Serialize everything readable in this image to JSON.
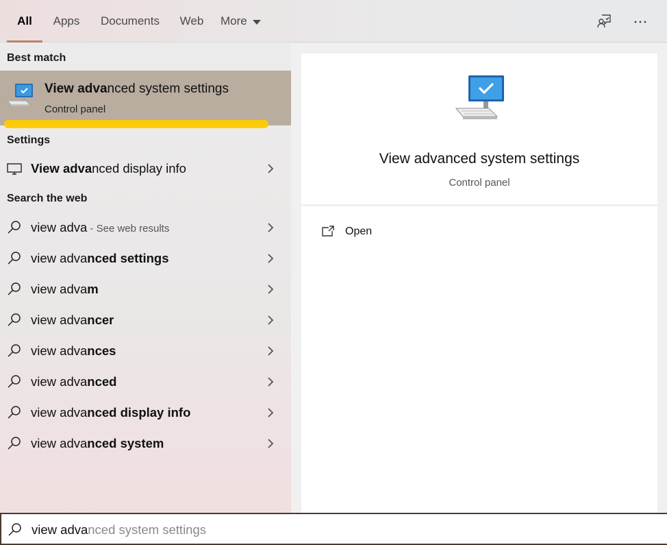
{
  "tabs": [
    {
      "label": "All",
      "active": true
    },
    {
      "label": "Apps"
    },
    {
      "label": "Documents"
    },
    {
      "label": "Web"
    },
    {
      "label": "More"
    }
  ],
  "top_icons": [
    "feedback-icon",
    "more-options-icon"
  ],
  "sections": {
    "best_match": "Best match",
    "settings": "Settings",
    "search_web": "Search the web"
  },
  "best_match": {
    "title_bold": "View adva",
    "title_rest": "nced system settings",
    "subtitle": "Control panel",
    "icon": "computer-monitor-icon"
  },
  "settings_items": [
    {
      "bold": "View adva",
      "rest": "nced display info"
    }
  ],
  "web_items": [
    {
      "plain": "view adva",
      "suffix": " - See web results"
    },
    {
      "plain": "view adva",
      "bold": "nced settings"
    },
    {
      "plain": "view adva",
      "bold": "m"
    },
    {
      "plain": "view adva",
      "bold": "ncer"
    },
    {
      "plain": "view adva",
      "bold": "nces"
    },
    {
      "plain": "view adva",
      "bold": "nced"
    },
    {
      "plain": "view adva",
      "bold": "nced display info"
    },
    {
      "plain": "view adva",
      "bold": "nced system"
    }
  ],
  "preview": {
    "title": "View advanced system settings",
    "subtitle": "Control panel",
    "actions": [
      {
        "label": "Open",
        "icon": "open-external-icon"
      }
    ]
  },
  "search": {
    "typed": "view adva",
    "suggestion": "nced system settings"
  },
  "colors": {
    "selected_row": "#b8ad9f",
    "tab_underline": "#b9846b",
    "highlight_stroke": "#ffcc00",
    "search_border": "#4a3a2e"
  }
}
